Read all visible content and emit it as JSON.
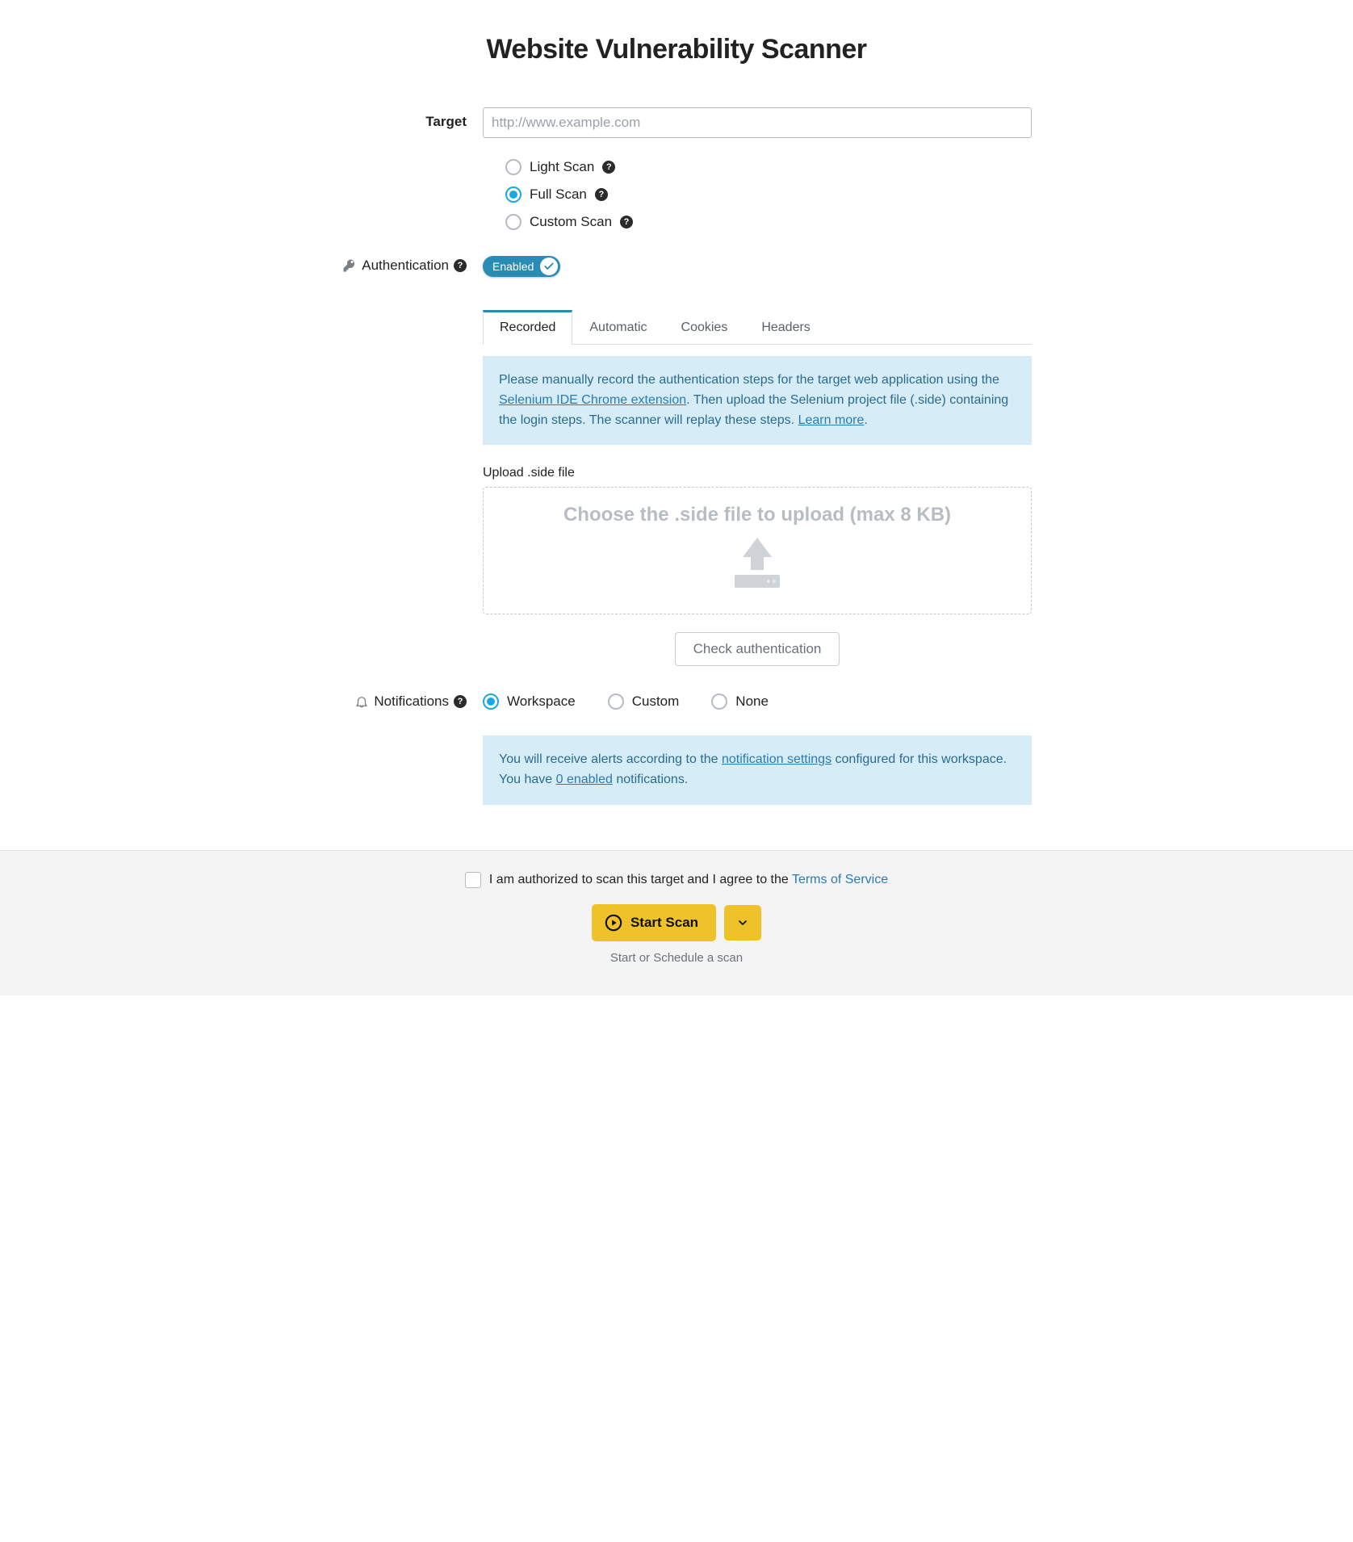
{
  "title": "Website Vulnerability Scanner",
  "target": {
    "label": "Target",
    "placeholder": "http://www.example.com",
    "value": ""
  },
  "scan_types": {
    "options": [
      {
        "label": "Light Scan",
        "selected": false
      },
      {
        "label": "Full Scan",
        "selected": true
      },
      {
        "label": "Custom Scan",
        "selected": false
      }
    ]
  },
  "authentication": {
    "label": "Authentication",
    "toggle_label": "Enabled",
    "tabs": [
      "Recorded",
      "Automatic",
      "Cookies",
      "Headers"
    ],
    "active_tab": "Recorded",
    "info_text_1": "Please manually record the authentication steps for the target web application using the ",
    "info_link_1": "Selenium IDE Chrome extension",
    "info_text_2": ". Then upload the Selenium project file (.side) containing the login steps. The scanner will replay these steps. ",
    "info_link_2": "Learn more",
    "info_text_3": ".",
    "upload_label": "Upload .side file",
    "dropzone_text": "Choose the .side file to upload (max 8 KB)",
    "check_button": "Check authentication"
  },
  "notifications": {
    "label": "Notifications",
    "options": [
      {
        "label": "Workspace",
        "selected": true
      },
      {
        "label": "Custom",
        "selected": false
      },
      {
        "label": "None",
        "selected": false
      }
    ],
    "info_text_1": "You will receive alerts according to the ",
    "info_link_1": "notification settings",
    "info_text_2": " configured for this workspace. You have ",
    "info_link_2": "0 enabled",
    "info_text_3": " notifications."
  },
  "footer": {
    "agree_text": "I am authorized to scan this target and I agree to the ",
    "tos_text": "Terms of Service",
    "start_label": "Start Scan",
    "sub_text": "Start or Schedule a scan"
  }
}
